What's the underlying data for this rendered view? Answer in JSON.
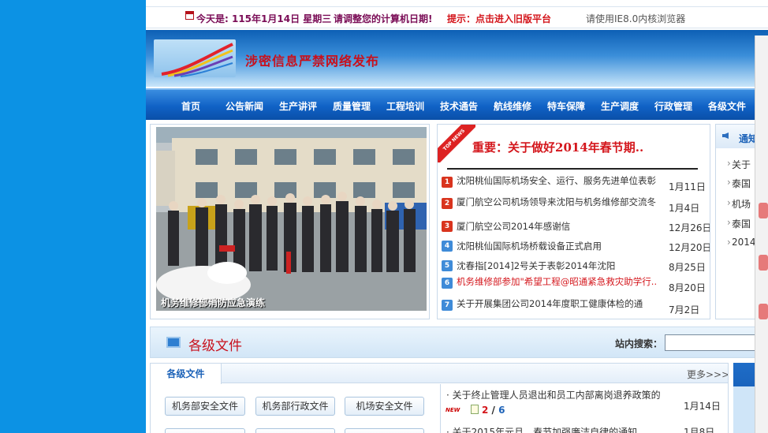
{
  "topbar": {
    "today": "今天是: 115年1月14日 星期三",
    "adjust_notice": "请调整您的计算机日期!",
    "tip": "提示：点击进入旧版平台",
    "browser_notice": "请使用IE8.0内核浏览器"
  },
  "banner": {
    "slogan": "涉密信息严禁网络发布"
  },
  "nav": {
    "items": [
      "首页",
      "公告新闻",
      "生产讲评",
      "质量管理",
      "工程培训",
      "技术通告",
      "航线维修",
      "特车保障",
      "生产调度",
      "行政管理",
      "各级文件"
    ]
  },
  "photo": {
    "caption": "机务维修部消防应急演练"
  },
  "news": {
    "ribbon": "TOP NEWS",
    "headline": "重要：关于做好2014年春节期..",
    "items": [
      {
        "num": "1",
        "title": "沈阳桃仙国际机场安全、运行、服务先进单位表彰",
        "date": "1月11日"
      },
      {
        "num": "2",
        "title": "厦门航空公司机场领导来沈阳与机务维修部交流冬",
        "date": "1月4日"
      },
      {
        "num": "3",
        "title": "厦门航空公司2014年感谢信",
        "date": "12月26日"
      },
      {
        "num": "4",
        "title": "沈阳桃仙国际机场桥载设备正式启用",
        "date": "12月20日"
      },
      {
        "num": "5",
        "title": "沈春指[2014]2号关于表彰2014年沈阳",
        "date": "8月25日"
      },
      {
        "num": "6",
        "title": "机务维修部参加\"希望工程@昭通紧急救灾助学行..",
        "date": "8月20日"
      },
      {
        "num": "7",
        "title": "关于开展集团公司2014年度职工健康体检的通",
        "date": "7月2日"
      }
    ]
  },
  "notice": {
    "title": "通知",
    "items": [
      "关于",
      "泰国",
      "机场",
      "泰国",
      "2014"
    ]
  },
  "section": {
    "title": "各级文件",
    "search_label": "站内搜索："
  },
  "files": {
    "tab": "各级文件",
    "more": "更多>>>",
    "buttons": [
      "机务部安全文件",
      "机务部行政文件",
      "机场安全文件"
    ],
    "list": [
      {
        "title": "· 关于终止管理人员退出和员工内部离岗退养政策的",
        "date": "1月14日"
      },
      {
        "title": "· 关于2015年元旦、春节加强廉洁自律的通知",
        "date": "1月8日"
      }
    ],
    "new_badge": "NEW",
    "pager_current": "2",
    "pager_sep": " / ",
    "pager_total": "6"
  }
}
